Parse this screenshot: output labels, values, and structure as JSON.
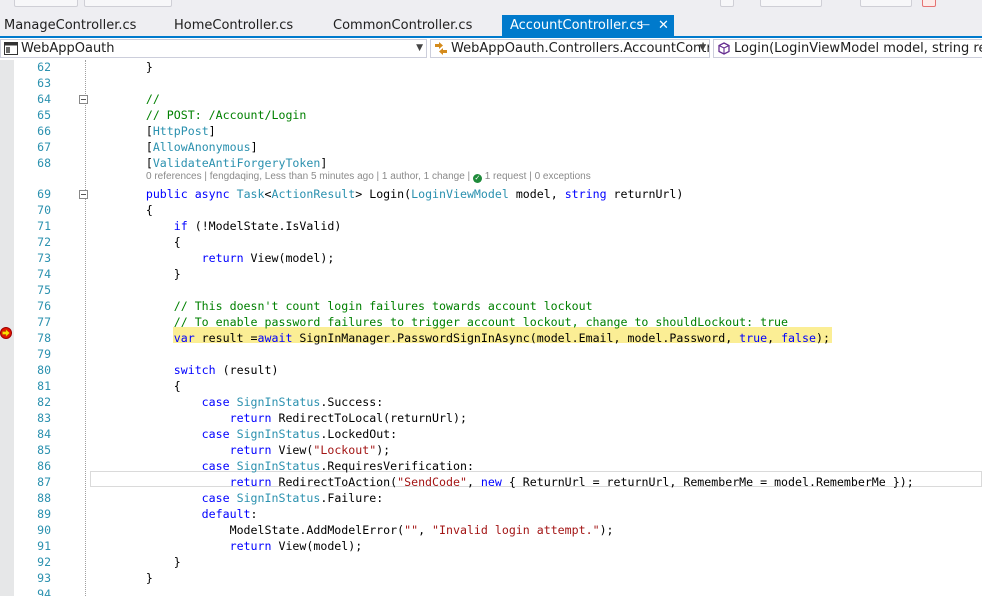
{
  "tabs": [
    {
      "label": "ManageController.cs",
      "active": false
    },
    {
      "label": "HomeController.cs",
      "active": false
    },
    {
      "label": "CommonController.cs",
      "active": false
    },
    {
      "label": "AccountController.cs",
      "active": true
    }
  ],
  "nav": {
    "project": "WebAppOauth",
    "class": "WebAppOauth.Controllers.AccountControl",
    "member": "Login(LoginViewModel model, string return"
  },
  "codelens": {
    "references": "0 references",
    "author_time": "fengdaqing, Less than 5 minutes ago",
    "authors": "1 author, 1 change",
    "requests": "1 request",
    "exceptions": "0 exceptions"
  },
  "lines": [
    {
      "n": "62",
      "tokens": [
        {
          "c": "p",
          "t": "        }"
        }
      ]
    },
    {
      "n": "63",
      "tokens": []
    },
    {
      "n": "64",
      "tokens": [
        {
          "c": "c",
          "t": "        //"
        }
      ]
    },
    {
      "n": "65",
      "tokens": [
        {
          "c": "c",
          "t": "        // POST: /Account/Login"
        }
      ]
    },
    {
      "n": "66",
      "tokens": [
        {
          "c": "p",
          "t": "        ["
        },
        {
          "c": "t",
          "t": "HttpPost"
        },
        {
          "c": "p",
          "t": "]"
        }
      ]
    },
    {
      "n": "67",
      "tokens": [
        {
          "c": "p",
          "t": "        ["
        },
        {
          "c": "t",
          "t": "AllowAnonymous"
        },
        {
          "c": "p",
          "t": "]"
        }
      ]
    },
    {
      "n": "68",
      "tokens": [
        {
          "c": "p",
          "t": "        ["
        },
        {
          "c": "t",
          "t": "ValidateAntiForgeryToken"
        },
        {
          "c": "p",
          "t": "]"
        }
      ]
    },
    {
      "n": "69",
      "tokens": [
        {
          "c": "k",
          "t": "        public async "
        },
        {
          "c": "t",
          "t": "Task"
        },
        {
          "c": "p",
          "t": "<"
        },
        {
          "c": "t",
          "t": "ActionResult"
        },
        {
          "c": "p",
          "t": "> Login("
        },
        {
          "c": "t",
          "t": "LoginViewModel"
        },
        {
          "c": "p",
          "t": " model, "
        },
        {
          "c": "k",
          "t": "string"
        },
        {
          "c": "p",
          "t": " returnUrl)"
        }
      ]
    },
    {
      "n": "70",
      "tokens": [
        {
          "c": "p",
          "t": "        {"
        }
      ]
    },
    {
      "n": "71",
      "tokens": [
        {
          "c": "k",
          "t": "            if"
        },
        {
          "c": "p",
          "t": " (!ModelState.IsValid)"
        }
      ]
    },
    {
      "n": "72",
      "tokens": [
        {
          "c": "p",
          "t": "            {"
        }
      ]
    },
    {
      "n": "73",
      "tokens": [
        {
          "c": "k",
          "t": "                return"
        },
        {
          "c": "p",
          "t": " View(model);"
        }
      ]
    },
    {
      "n": "74",
      "tokens": [
        {
          "c": "p",
          "t": "            }"
        }
      ]
    },
    {
      "n": "75",
      "tokens": []
    },
    {
      "n": "76",
      "tokens": [
        {
          "c": "c",
          "t": "            // This doesn't count login failures towards account lockout"
        }
      ]
    },
    {
      "n": "77",
      "tokens": [
        {
          "c": "c",
          "t": "            // To enable password failures to trigger account lockout, change to shouldLockout: true"
        }
      ]
    },
    {
      "n": "78",
      "tokens": [
        {
          "c": "k",
          "t": "            var"
        },
        {
          "c": "p",
          "t": " result ="
        },
        {
          "c": "k",
          "t": "await"
        },
        {
          "c": "p",
          "t": " SignInManager.PasswordSignInAsync(model.Email, model.Password, "
        },
        {
          "c": "k",
          "t": "true"
        },
        {
          "c": "p",
          "t": ", "
        },
        {
          "c": "k",
          "t": "false"
        },
        {
          "c": "p",
          "t": ");"
        }
      ]
    },
    {
      "n": "79",
      "tokens": []
    },
    {
      "n": "80",
      "tokens": [
        {
          "c": "k",
          "t": "            switch"
        },
        {
          "c": "p",
          "t": " (result)"
        }
      ]
    },
    {
      "n": "81",
      "tokens": [
        {
          "c": "p",
          "t": "            {"
        }
      ]
    },
    {
      "n": "82",
      "tokens": [
        {
          "c": "k",
          "t": "                case "
        },
        {
          "c": "t",
          "t": "SignInStatus"
        },
        {
          "c": "p",
          "t": ".Success:"
        }
      ]
    },
    {
      "n": "83",
      "tokens": [
        {
          "c": "k",
          "t": "                    return"
        },
        {
          "c": "p",
          "t": " RedirectToLocal(returnUrl);"
        }
      ]
    },
    {
      "n": "84",
      "tokens": [
        {
          "c": "k",
          "t": "                case "
        },
        {
          "c": "t",
          "t": "SignInStatus"
        },
        {
          "c": "p",
          "t": ".LockedOut:"
        }
      ]
    },
    {
      "n": "85",
      "tokens": [
        {
          "c": "k",
          "t": "                    return"
        },
        {
          "c": "p",
          "t": " View("
        },
        {
          "c": "s",
          "t": "\"Lockout\""
        },
        {
          "c": "p",
          "t": ");"
        }
      ]
    },
    {
      "n": "86",
      "tokens": [
        {
          "c": "k",
          "t": "                case "
        },
        {
          "c": "t",
          "t": "SignInStatus"
        },
        {
          "c": "p",
          "t": ".RequiresVerification:"
        }
      ]
    },
    {
      "n": "87",
      "tokens": [
        {
          "c": "k",
          "t": "                    return"
        },
        {
          "c": "p",
          "t": " RedirectToAction("
        },
        {
          "c": "s",
          "t": "\"SendCode\""
        },
        {
          "c": "p",
          "t": ", "
        },
        {
          "c": "k",
          "t": "new"
        },
        {
          "c": "p",
          "t": " { ReturnUrl = returnUrl, RememberMe = model.RememberMe });"
        }
      ]
    },
    {
      "n": "88",
      "tokens": [
        {
          "c": "k",
          "t": "                case "
        },
        {
          "c": "t",
          "t": "SignInStatus"
        },
        {
          "c": "p",
          "t": ".Failure:"
        }
      ]
    },
    {
      "n": "89",
      "tokens": [
        {
          "c": "k",
          "t": "                default"
        },
        {
          "c": "p",
          "t": ":"
        }
      ]
    },
    {
      "n": "90",
      "tokens": [
        {
          "c": "p",
          "t": "                    ModelState.AddModelError("
        },
        {
          "c": "s",
          "t": "\"\""
        },
        {
          "c": "p",
          "t": ", "
        },
        {
          "c": "s",
          "t": "\"Invalid login attempt.\""
        },
        {
          "c": "p",
          "t": ");"
        }
      ]
    },
    {
      "n": "91",
      "tokens": [
        {
          "c": "k",
          "t": "                    return"
        },
        {
          "c": "p",
          "t": " View(model);"
        }
      ]
    },
    {
      "n": "92",
      "tokens": [
        {
          "c": "p",
          "t": "            }"
        }
      ]
    },
    {
      "n": "93",
      "tokens": [
        {
          "c": "p",
          "t": "        }"
        }
      ]
    },
    {
      "n": "94",
      "tokens": []
    }
  ],
  "colors": {
    "keyword": "#0000ff",
    "type": "#2b91af",
    "comment": "#008000",
    "string": "#a31515",
    "tab_active": "#007acc",
    "exec_highlight": "#fbee95"
  },
  "execution_line": "78",
  "current_line": "87",
  "fold_lines": [
    "64",
    "69"
  ],
  "icons": {
    "pin": "pin-icon",
    "close": "close-icon",
    "breakpoint": "execution-pointer-icon"
  }
}
